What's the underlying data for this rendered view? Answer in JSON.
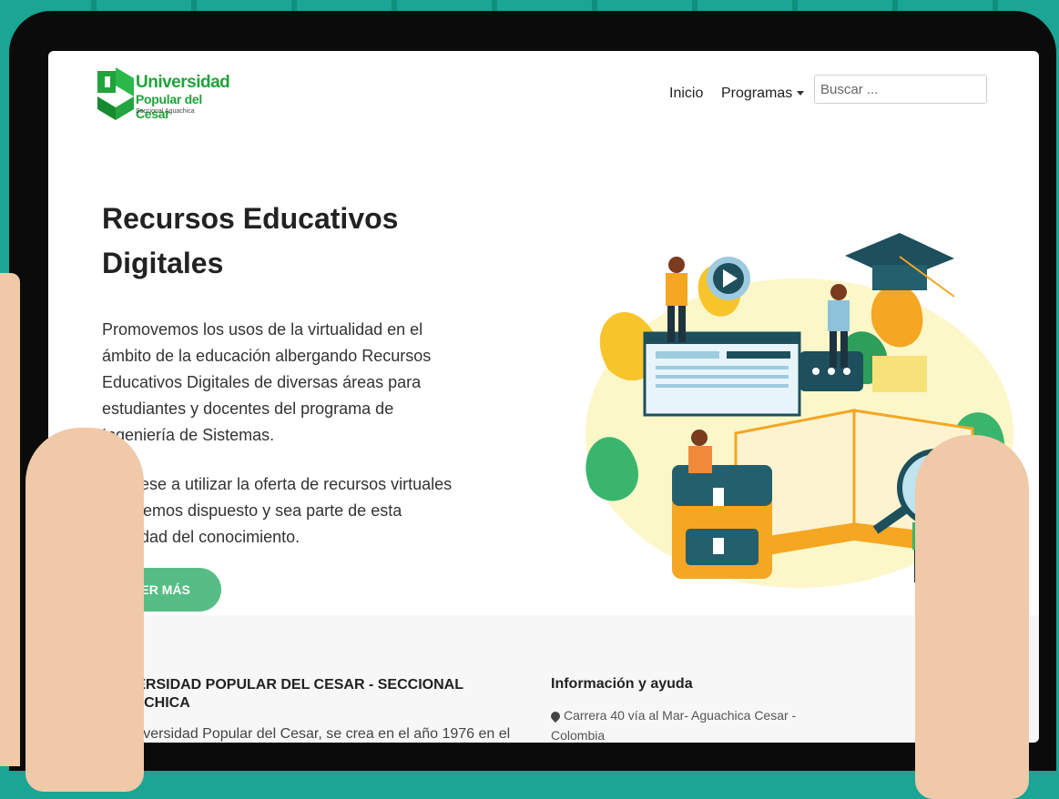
{
  "header": {
    "logo": {
      "line1": "Universidad",
      "line2": "Popular del Cesar",
      "line3": "Seccional Aguachica"
    },
    "nav": {
      "inicio": "Inicio",
      "programas": "Programas"
    },
    "search_placeholder": "Buscar ..."
  },
  "hero": {
    "title": "Recursos Educativos Digitales",
    "paragraph1": "Promovemos los usos de la virtualidad en el ámbito de la educación albergando Recursos Educativos Digitales de diversas áreas para estudiantes y docentes del programa de Ingeniería de Sistemas.",
    "paragraph2": "Anímese a utilizar la oferta de recursos virtuales que hemos dispuesto y sea parte de esta sociedad del conocimiento.",
    "button": "VER MÁS"
  },
  "footer": {
    "col1_title": "UNIVERSIDAD POPULAR DEL CESAR - SECCIONAL AGUACHICA",
    "col1_text": "La Universidad Popular del Cesar, se crea en el año 1976 en el",
    "col2_title": "Información y ayuda",
    "col2_address": "Carrera 40 vía al Mar- Aguachica Cesar - Colombia"
  },
  "colors": {
    "brand_green": "#1fa33a",
    "button_green": "#57bd86",
    "background_teal": "#1aa594"
  }
}
